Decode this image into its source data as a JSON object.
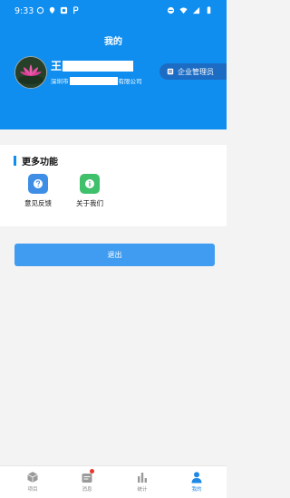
{
  "status_bar": {
    "time": "9:33"
  },
  "header": {
    "title": "我的",
    "user_name": "王",
    "company_prefix": "深圳市",
    "company_suffix": "有限公司",
    "role_badge": "企业管理员"
  },
  "features": {
    "title": "更多功能",
    "items": [
      {
        "label": "意见反馈",
        "icon": "feedback-icon"
      },
      {
        "label": "关于我们",
        "icon": "info-icon"
      }
    ]
  },
  "logout": {
    "label": "退出"
  },
  "tabbar": {
    "items": [
      {
        "label": "项目",
        "icon": "cube-icon",
        "active": false
      },
      {
        "label": "消息",
        "icon": "message-icon",
        "active": false,
        "badge": true
      },
      {
        "label": "统计",
        "icon": "bar-chart-icon",
        "active": false
      },
      {
        "label": "我的",
        "icon": "person-icon",
        "active": true
      }
    ]
  },
  "colors": {
    "primary": "#0f8ef0",
    "button": "#409cf0",
    "feedback_icon_bg": "#3f8ee6",
    "about_icon_bg": "#3fc06a",
    "badge_dot": "#e8362e",
    "tab_active": "#1e88e5"
  }
}
